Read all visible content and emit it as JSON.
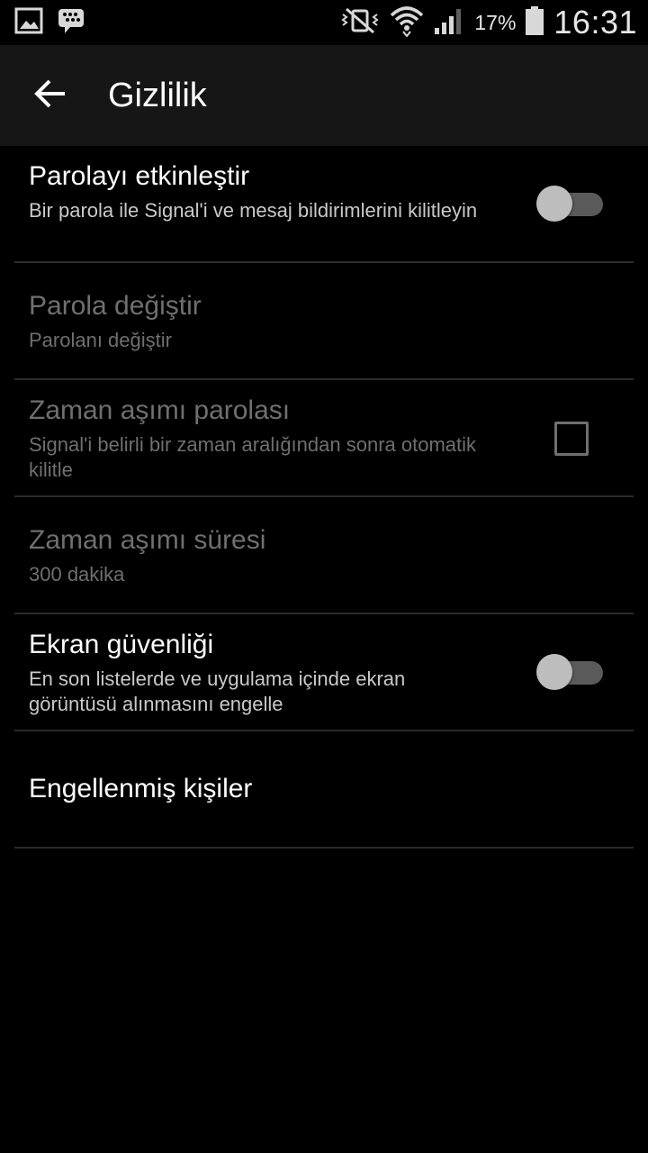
{
  "status_bar": {
    "left_icons": [
      "gallery-icon",
      "bbm-icon"
    ],
    "right_icons": [
      "vibrate-mute-icon",
      "wifi-icon",
      "signal-icon",
      "battery-icon"
    ],
    "battery_percent": "17%",
    "time": "16:31"
  },
  "toolbar": {
    "title": "Gizlilik",
    "back_icon": "arrow-back-icon"
  },
  "settings": {
    "items": [
      {
        "title": "Parolayı etkinleştir",
        "summary": "Bir parola ile Signal'i ve mesaj bildirimlerini kilitleyin",
        "control": "switch",
        "checked": false,
        "enabled": true
      },
      {
        "title": "Parola değiştir",
        "summary": "Parolanı değiştir",
        "enabled": false
      },
      {
        "title": "Zaman aşımı parolası",
        "summary": "Signal'i belirli bir zaman aralığından sonra otomatik kilitle",
        "control": "checkbox",
        "checked": false,
        "enabled": false
      },
      {
        "title": "Zaman aşımı süresi",
        "summary": "300 dakika",
        "enabled": false
      },
      {
        "title": "Ekran güvenliği",
        "summary": "En son listelerde ve uygulama içinde ekran görüntüsü alınmasını engelle",
        "control": "switch",
        "checked": false,
        "enabled": true
      },
      {
        "title": "Engellenmiş kişiler",
        "enabled": true
      }
    ]
  },
  "colors": {
    "background": "#000000",
    "toolbar": "#161616",
    "divider": "#2b2b2b",
    "disabled_text": "#6f6f6f"
  }
}
